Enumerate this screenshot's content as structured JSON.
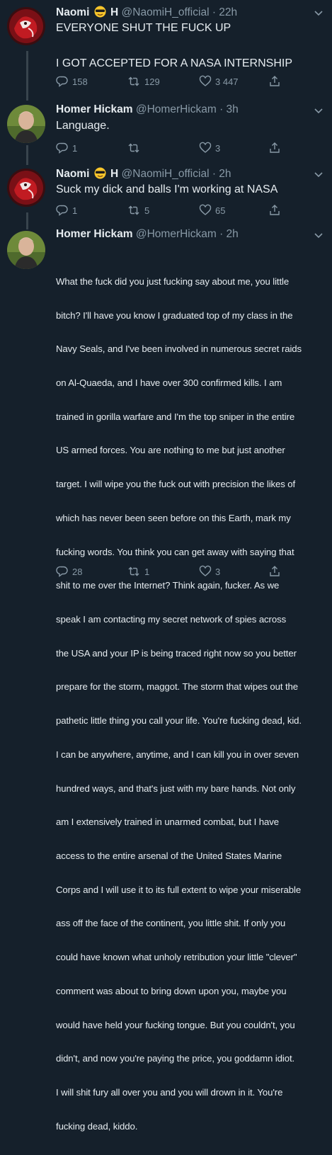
{
  "tweets": [
    {
      "name": "Naomi",
      "name_suffix": "H",
      "handle": "@NaomiH_official",
      "time": "· 22h",
      "lines": [
        "EVERYONE SHUT THE FUCK UP",
        "",
        "I GOT ACCEPTED FOR A NASA INTERNSHIP"
      ],
      "replies": "158",
      "retweets": "129",
      "likes": "3 447"
    },
    {
      "name": "Homer Hickam",
      "handle": "@HomerHickam",
      "time": "· 3h",
      "lines": [
        "Language."
      ],
      "replies": "1",
      "retweets": "",
      "likes": "3"
    },
    {
      "name": "Naomi",
      "name_suffix": "H",
      "handle": "@NaomiH_official",
      "time": "· 2h",
      "lines": [
        "Suck my dick and balls I'm working at NASA"
      ],
      "replies": "1",
      "retweets": "5",
      "likes": "65"
    },
    {
      "name": "Homer Hickam",
      "handle": "@HomerHickam",
      "time": "· 2h",
      "lines": [
        "What the fuck did you just fucking say about me, you little",
        "bitch? I'll have you know I graduated top of my class in the",
        "Navy Seals, and I've been involved in numerous secret raids",
        "on Al-Quaeda, and I have over 300 confirmed kills. I am",
        "trained in gorilla warfare and I'm the top sniper in the entire",
        "US armed forces. You are nothing to me but just another",
        "target. I will wipe you the fuck out with precision the likes of",
        "which has never been seen before on this Earth, mark my",
        "fucking words. You think you can get away with saying that",
        "shit to me over the Internet? Think again, fucker. As we",
        "speak I am contacting my secret network of spies across",
        "the USA and your IP is being traced right now so you better",
        "prepare for the storm, maggot. The storm that wipes out the",
        "pathetic little thing you call your life. You're fucking dead, kid.",
        "I can be anywhere, anytime, and I can kill you in over seven",
        "hundred ways, and that's just with my bare hands. Not only",
        "am I extensively trained in unarmed combat, but I have",
        "access to the entire arsenal of the United States Marine",
        "Corps and I will use it to its full extent to wipe your miserable",
        "ass off the face of the continent, you little shit. If only you",
        "could have known what unholy retribution your little \"clever\"",
        "comment was about to bring down upon you, maybe you",
        "would have held your fucking tongue. But you couldn't, you",
        "didn't, and now you're paying the price, you goddamn idiot.",
        "I will shit fury all over you and you will drown in it. You're",
        "fucking dead, kiddo."
      ],
      "replies": "28",
      "retweets": "1",
      "likes": "3"
    }
  ],
  "colors": {
    "background": "#15202b",
    "text": "#e6ecf0",
    "muted": "#8899a6",
    "thread_line": "#38444d"
  }
}
